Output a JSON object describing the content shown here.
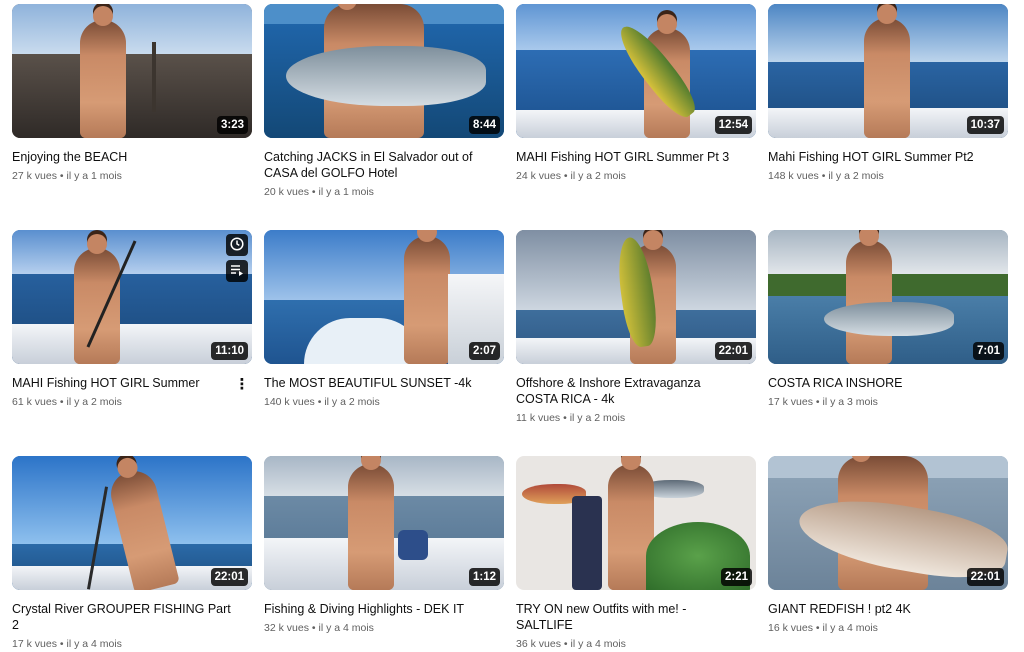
{
  "videos": [
    {
      "title": "Enjoying the BEACH",
      "views": "27 k vues",
      "age": "il y a 1 mois",
      "duration": "3:23"
    },
    {
      "title": "Catching JACKS in El Salvador out of CASA del GOLFO Hotel",
      "views": "20 k vues",
      "age": "il y a 1 mois",
      "duration": "8:44"
    },
    {
      "title": "MAHI Fishing HOT GIRL Summer Pt 3",
      "views": "24 k vues",
      "age": "il y a 2 mois",
      "duration": "12:54"
    },
    {
      "title": "Mahi Fishing HOT GIRL Summer Pt2",
      "views": "148 k vues",
      "age": "il y a 2 mois",
      "duration": "10:37"
    },
    {
      "title": "MAHI Fishing HOT GIRL Summer",
      "views": "61 k vues",
      "age": "il y a 2 mois",
      "duration": "11:10"
    },
    {
      "title": "The MOST BEAUTIFUL SUNSET -4k",
      "views": "140 k vues",
      "age": "il y a 2 mois",
      "duration": "2:07"
    },
    {
      "title": "Offshore & Inshore Extravaganza COSTA RICA - 4k",
      "views": "11 k vues",
      "age": "il y a 2 mois",
      "duration": "22:01"
    },
    {
      "title": "COSTA RICA INSHORE",
      "views": "17 k vues",
      "age": "il y a 3 mois",
      "duration": "7:01"
    },
    {
      "title": "Crystal River GROUPER FISHING Part 2",
      "views": "17 k vues",
      "age": "il y a 4 mois",
      "duration": "22:01"
    },
    {
      "title": "Fishing & Diving Highlights - DEK IT",
      "views": "32 k vues",
      "age": "il y a 4 mois",
      "duration": "1:12"
    },
    {
      "title": "TRY ON new Outfits with me! - SALTLIFE",
      "views": "36 k vues",
      "age": "il y a 4 mois",
      "duration": "2:21"
    },
    {
      "title": "GIANT REDFISH ! pt2 4K",
      "views": "16 k vues",
      "age": "il y a 4 mois",
      "duration": "22:01"
    }
  ],
  "meta_separator": "•",
  "icons": {
    "watch_later": "clock-icon",
    "add_to_queue": "queue-icon",
    "more": "vertical-dots-icon"
  }
}
